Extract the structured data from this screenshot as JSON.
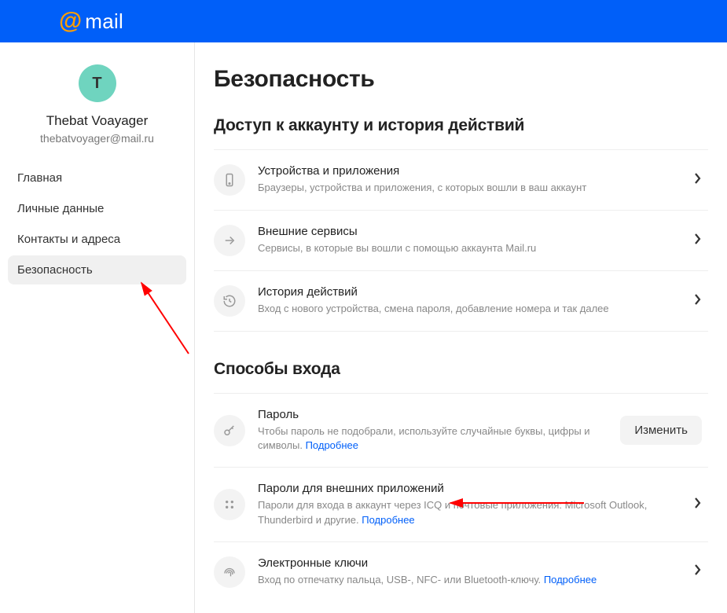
{
  "brand": {
    "text": "mail"
  },
  "user": {
    "initial": "T",
    "name": "Thebat Voayager",
    "email": "thebatvoyager@mail.ru"
  },
  "sidebar": {
    "items": [
      {
        "label": "Главная"
      },
      {
        "label": "Личные данные"
      },
      {
        "label": "Контакты и адреса"
      },
      {
        "label": "Безопасность"
      }
    ],
    "activeIndex": 3
  },
  "page": {
    "title": "Безопасность"
  },
  "sections": {
    "access": {
      "title": "Доступ к аккаунту и история действий",
      "items": [
        {
          "title": "Устройства и приложения",
          "desc": "Браузеры, устройства и приложения, с которых вошли в ваш аккаунт"
        },
        {
          "title": "Внешние сервисы",
          "desc": "Сервисы, в которые вы вошли с помощью аккаунта Mail.ru"
        },
        {
          "title": "История действий",
          "desc": "Вход с нового устройства, смена пароля, добавление номера и так далее"
        }
      ]
    },
    "login": {
      "title": "Способы входа",
      "items": [
        {
          "title": "Пароль",
          "desc": "Чтобы пароль не подобрали, используйте случайные буквы, цифры и символы.",
          "more": "Подробнее",
          "button": "Изменить"
        },
        {
          "title": "Пароли для внешних приложений",
          "desc": "Пароли для входа в аккаунт через ICQ и почтовые приложения: Microsoft Outlook, Thunderbird и другие.",
          "more": "Подробнее"
        },
        {
          "title": "Электронные ключи",
          "desc": "Вход по отпечатку пальца, USB-, NFC- или Bluetooth-ключу.",
          "more": "Подробнее"
        }
      ]
    }
  }
}
